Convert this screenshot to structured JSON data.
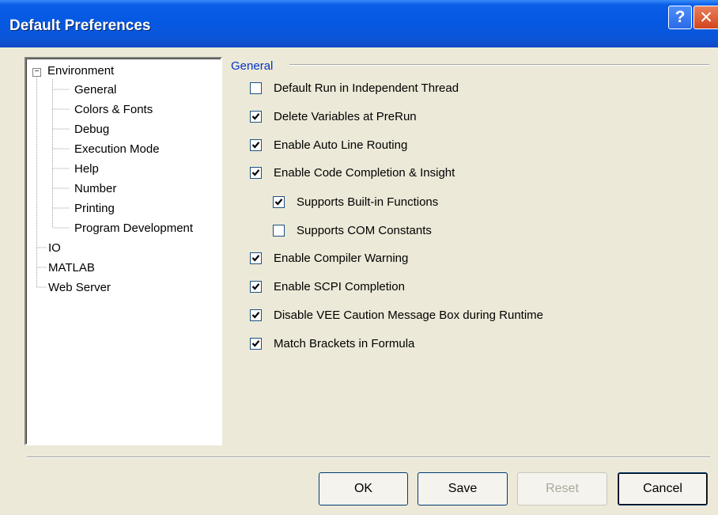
{
  "window": {
    "title": "Default Preferences",
    "help_label": "?",
    "close_label": "✕"
  },
  "tree": {
    "expander_symbol": "−",
    "items": [
      {
        "label": "Environment"
      },
      {
        "label": "General"
      },
      {
        "label": "Colors & Fonts"
      },
      {
        "label": "Debug"
      },
      {
        "label": "Execution Mode"
      },
      {
        "label": "Help"
      },
      {
        "label": "Number"
      },
      {
        "label": "Printing"
      },
      {
        "label": "Program Development"
      },
      {
        "label": "IO"
      },
      {
        "label": "MATLAB"
      },
      {
        "label": "Web Server"
      }
    ]
  },
  "panel": {
    "group_label": "General",
    "options": [
      {
        "label": "Default Run in Independent Thread",
        "checked": false
      },
      {
        "label": "Delete Variables at PreRun",
        "checked": true
      },
      {
        "label": "Enable Auto Line Routing",
        "checked": true
      },
      {
        "label": "Enable Code Completion & Insight",
        "checked": true
      },
      {
        "label": "Supports Built-in Functions",
        "checked": true
      },
      {
        "label": "Supports COM Constants",
        "checked": false
      },
      {
        "label": "Enable Compiler Warning",
        "checked": true
      },
      {
        "label": "Enable SCPI Completion",
        "checked": true
      },
      {
        "label": "Disable VEE Caution Message Box during Runtime",
        "checked": true
      },
      {
        "label": "Match Brackets in Formula",
        "checked": true
      }
    ]
  },
  "buttons": {
    "ok": "OK",
    "save": "Save",
    "reset": "Reset",
    "cancel": "Cancel"
  }
}
